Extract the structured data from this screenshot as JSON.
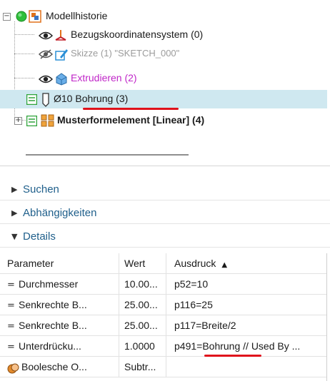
{
  "tree": {
    "root": {
      "label": "Modellhistorie",
      "icons": [
        "collapse-icon",
        "green-status-icon",
        "model-history-icon"
      ]
    },
    "items": [
      {
        "label": "Bezugskoordinatensystem (0)",
        "style": "normal",
        "icons": [
          "eye-icon",
          "datum-csys-icon"
        ]
      },
      {
        "label": "Skizze (1) \"SKETCH_000\"",
        "style": "grayed",
        "icons": [
          "hidden-eye-icon",
          "sketch-icon"
        ]
      },
      {
        "label": "Extrudieren (2)",
        "style": "magenta",
        "icons": [
          "eye-icon",
          "extrude-icon"
        ]
      },
      {
        "label": "Ø10 Bohrung (3)",
        "style": "selected",
        "icons": [
          "green-check-box-icon",
          "hole-icon"
        ]
      },
      {
        "label": "Musterformelement [Linear] (4)",
        "style": "bold",
        "icons": [
          "expand-icon",
          "green-check-box-icon",
          "pattern-icon"
        ]
      }
    ]
  },
  "sections": [
    {
      "label": "Suchen",
      "expanded": false
    },
    {
      "label": "Abhängigkeiten",
      "expanded": false
    },
    {
      "label": "Details",
      "expanded": true
    }
  ],
  "details_table": {
    "headers": {
      "param": "Parameter",
      "value": "Wert",
      "expr": "Ausdruck"
    },
    "sort": "ascending",
    "rows": [
      {
        "param": "Durchmesser",
        "value": "10.00...",
        "expr_a": "p52=10",
        "expr_b": "",
        "expr_c": "",
        "icon": "equals-icon"
      },
      {
        "param": "Senkrechte B...",
        "value": "25.00...",
        "expr_a": "p116=25",
        "expr_b": "",
        "expr_c": "",
        "icon": "equals-icon"
      },
      {
        "param": "Senkrechte B...",
        "value": "25.00...",
        "expr_a": "p117=Breite/2",
        "expr_b": "",
        "expr_c": "",
        "icon": "equals-icon"
      },
      {
        "param": "Unterdrücku...",
        "value": "1.0000",
        "expr_a": "p491=",
        "expr_b": "Bohrung",
        "expr_c": " // Used By ...",
        "icon": "equals-icon"
      },
      {
        "param": "Boolesche O...",
        "value": "Subtr...",
        "expr_a": "",
        "expr_b": "",
        "expr_c": "",
        "icon": "boolean-icon"
      }
    ]
  },
  "colors": {
    "selection": "#cfe8f0",
    "magenta_text": "#c026c8",
    "grayed_text": "#9c9c9c",
    "section_title": "#1f5f8b",
    "annotation_red": "#e0121b"
  }
}
